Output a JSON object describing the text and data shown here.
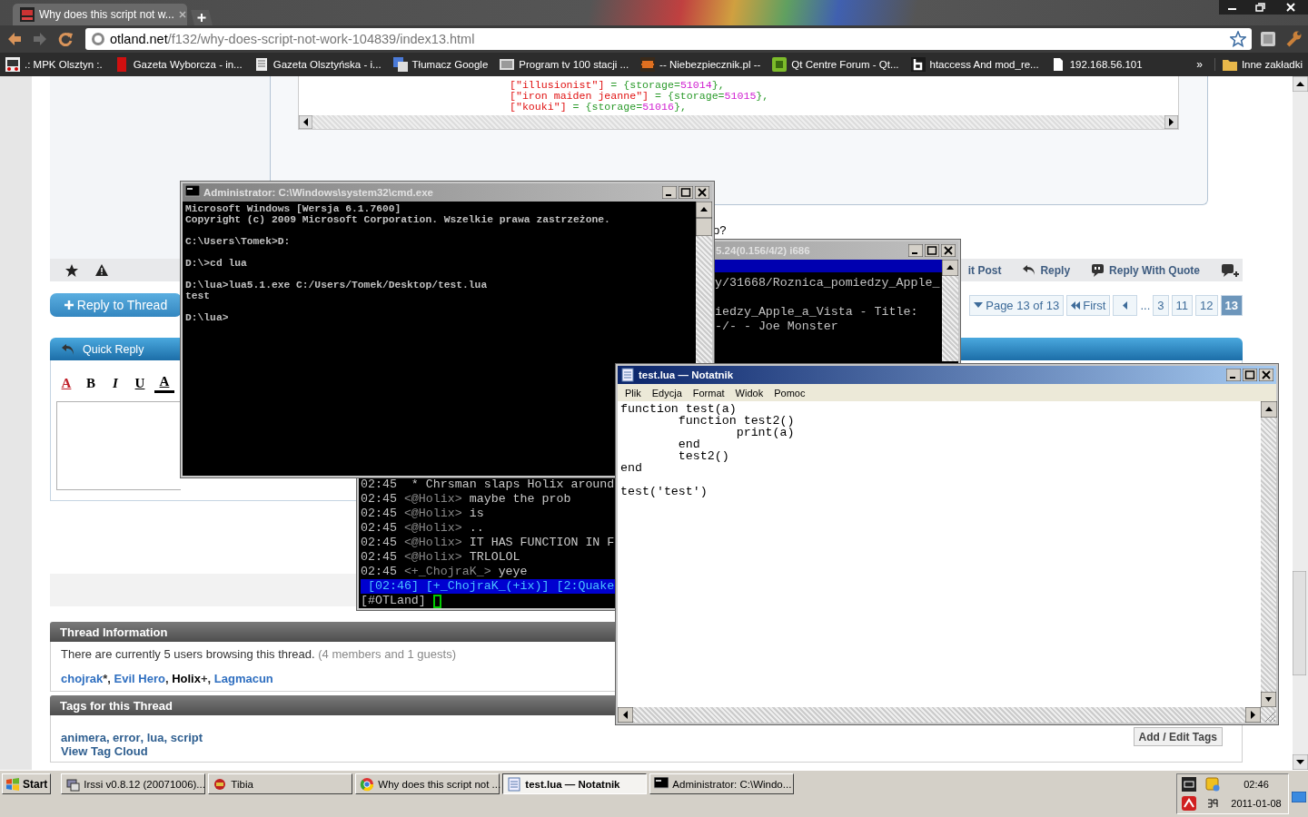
{
  "browser": {
    "tabs": [
      {
        "title": "Why does this script not w...",
        "selected": true
      }
    ],
    "address": {
      "host": "otland.net",
      "path": "/f132/why-does-script-not-work-104839/index13.html"
    },
    "bookmarks": [
      {
        "label": ".: MPK Olsztyn :.",
        "kind": "mpk"
      },
      {
        "label": "Gazeta Wyborcza - in...",
        "kind": "red"
      },
      {
        "label": "Gazeta Olsztyńska - i...",
        "kind": "page"
      },
      {
        "label": "Tłumacz Google",
        "kind": "translate"
      },
      {
        "label": "Program tv  100 stacji ...",
        "kind": "tv"
      },
      {
        "label": "-- Niebezpiecznik.pl --",
        "kind": "invader"
      },
      {
        "label": "Qt Centre Forum - Qt...",
        "kind": "qt"
      },
      {
        "label": "htaccess And mod_re...",
        "kind": "letter"
      },
      {
        "label": "192.168.56.101",
        "kind": "file"
      }
    ],
    "bookmarks_overflow": "»",
    "other_bookmarks": "Inne zakładki",
    "page": {
      "code_lines": [
        {
          "key": "[\"illusionist\"]",
          "assign": " = {storage=",
          "value": "51014",
          "close": "},"
        },
        {
          "key": "[\"iron maiden jeanne\"]",
          "assign": " = {storage=",
          "value": "51015",
          "close": "},"
        },
        {
          "key": "[\"kouki\"]",
          "assign": " = {storage=",
          "value": "51016",
          "close": "},"
        }
      ],
      "post_text": "o?",
      "post_actions": [
        {
          "label": "it Post",
          "kind": "edit"
        },
        {
          "label": "Reply",
          "kind": "reply"
        },
        {
          "label": "Reply With Quote",
          "kind": "quote"
        }
      ],
      "reply_button": "Reply to Thread",
      "pagination": {
        "label": "Page 13 of 13",
        "first": "First",
        "ellipsis": "...",
        "pages": [
          {
            "label": "3",
            "selected": false
          },
          {
            "label": "11",
            "selected": false
          },
          {
            "label": "12",
            "selected": false
          },
          {
            "label": "13",
            "selected": true
          }
        ]
      },
      "quick_reply": "Quick Reply",
      "format_buttons": [
        {
          "label": "A",
          "kind": "font"
        },
        {
          "label": "B",
          "kind": "bold"
        },
        {
          "label": "I",
          "kind": "italic"
        },
        {
          "label": "U",
          "kind": "underline"
        },
        {
          "label": "A",
          "kind": "color"
        }
      ],
      "thread_info": {
        "title": "Thread Information",
        "text": "There are currently 5 users browsing this thread.",
        "detail": " (4 members and 1 guests)",
        "users": [
          {
            "name": "chojrak",
            "after": "*, ",
            "kind": "link"
          },
          {
            "name": "Evil Hero",
            "after": ", ",
            "kind": "link"
          },
          {
            "name": "Holix",
            "after": "+, ",
            "kind": "plain"
          },
          {
            "name": "Lagmacun",
            "kind": "link"
          }
        ]
      },
      "tags": {
        "title": "Tags for this Thread",
        "items": [
          {
            "name": "animera",
            "after": ", "
          },
          {
            "name": "error",
            "after": ", "
          },
          {
            "name": "lua",
            "after": ", "
          },
          {
            "name": "script"
          }
        ],
        "cloud": "View Tag Cloud",
        "edit_button": "Add / Edit Tags"
      }
    }
  },
  "windows": [
    {
      "kind": "irssi",
      "title": "5.24(0.156/4/2) i686",
      "active": false,
      "upper_text": "y/31668/Roznica_pomiedzy_Apple_\n\niedzy_Apple_a_Vista - Title:\n-/- - Joe Monster",
      "lines": [
        {
          "time": "02:45",
          "text": " * Chrsman slaps Holix around"
        },
        {
          "time": "02:45",
          "nick": "<@Holix>",
          "text": "maybe the prob"
        },
        {
          "time": "02:45",
          "nick": "<@Holix>",
          "text": "is"
        },
        {
          "time": "02:45",
          "nick": "<@Holix>",
          "text": ".."
        },
        {
          "time": "02:45",
          "nick": "<@Holix>",
          "text": "IT HAS FUNCTION IN F"
        },
        {
          "time": "02:45",
          "nick": "<@Holix>",
          "text": "TRLOLOL"
        },
        {
          "time": "02:45",
          "nick": "<+_ChojraK_>",
          "text": "yeye"
        }
      ],
      "status": "[02:46] [+_ChojraK_(+ix)] [2:Quake",
      "prompt": "[#OTLand]"
    },
    {
      "kind": "console",
      "title": "Administrator: C:\\Windows\\system32\\cmd.exe",
      "active": false,
      "text": "Microsoft Windows [Wersja 6.1.7600]\nCopyright (c) 2009 Microsoft Corporation. Wszelkie prawa zastrzeżone.\n\nC:\\Users\\Tomek>D:\n\nD:\\>cd lua\n\nD:\\lua>lua5.1.exe C:/Users/Tomek/Desktop/test.lua\ntest\n\nD:\\lua>"
    },
    {
      "kind": "notepad",
      "title": "test.lua — Notatnik",
      "active": true,
      "menu": [
        "Plik",
        "Edycja",
        "Format",
        "Widok",
        "Pomoc"
      ],
      "text": "function test(a)\n\tfunction test2()\n\t\tprint(a)\n\tend\n\ttest2()\nend\n\ntest('test')"
    }
  ],
  "taskbar": {
    "start": "Start",
    "tasks": [
      {
        "label": "Irssi v0.8.12 (20071006)...",
        "kind": "irssi",
        "selected": false
      },
      {
        "label": "Tibia",
        "kind": "tibia",
        "selected": false
      },
      {
        "label": "Why does this script not ...",
        "kind": "browser",
        "selected": false
      },
      {
        "label": "test.lua — Notatnik",
        "kind": "notepad",
        "selected": true
      },
      {
        "label": "Administrator: C:\\Windo...",
        "kind": "console",
        "selected": false
      }
    ],
    "time": "02:46",
    "date": "2011-01-08"
  }
}
